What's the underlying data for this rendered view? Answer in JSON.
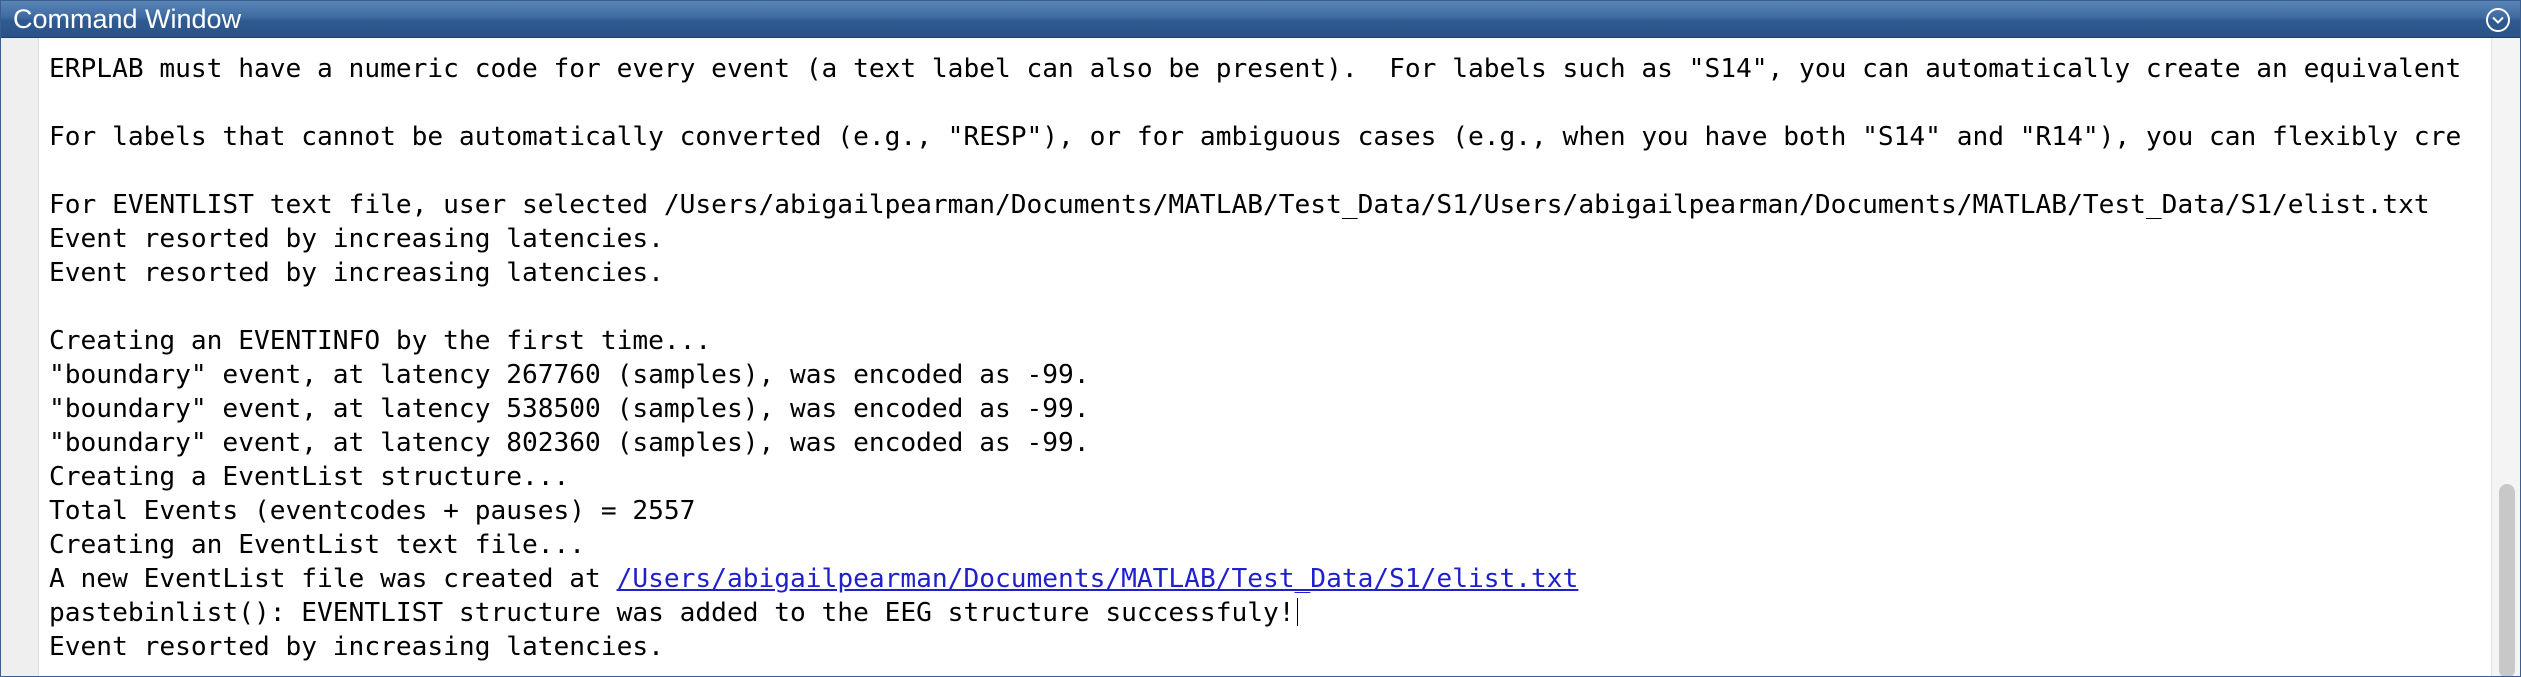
{
  "window": {
    "title": "Command Window",
    "menu_icon": "chevron-down-circle-icon"
  },
  "output": {
    "lines": [
      "ERPLAB must have a numeric code for every event (a text label can also be present).  For labels such as \"S14\", you can automatically create an equivalent",
      "",
      "For labels that cannot be automatically converted (e.g., \"RESP\"), or for ambiguous cases (e.g., when you have both \"S14\" and \"R14\"), you can flexibly cre",
      "",
      "For EVENTLIST text file, user selected /Users/abigailpearman/Documents/MATLAB/Test_Data/S1/Users/abigailpearman/Documents/MATLAB/Test_Data/S1/elist.txt",
      "Event resorted by increasing latencies.",
      "Event resorted by increasing latencies.",
      "",
      "Creating an EVENTINFO by the first time...",
      "\"boundary\" event, at latency 267760 (samples), was encoded as -99.",
      "\"boundary\" event, at latency 538500 (samples), was encoded as -99.",
      "\"boundary\" event, at latency 802360 (samples), was encoded as -99.",
      "Creating a EventList structure...",
      "Total Events (eventcodes + pauses) = 2557",
      "Creating an EventList text file..."
    ],
    "created_line": {
      "prefix": "A new EventList file was created at ",
      "link": "/Users/abigailpearman/Documents/MATLAB/Test_Data/S1/elist.txt"
    },
    "success_line": "pastebinlist(): EVENTLIST structure was added to the EEG structure successfuly!",
    "last_line": "Event resorted by increasing latencies."
  }
}
